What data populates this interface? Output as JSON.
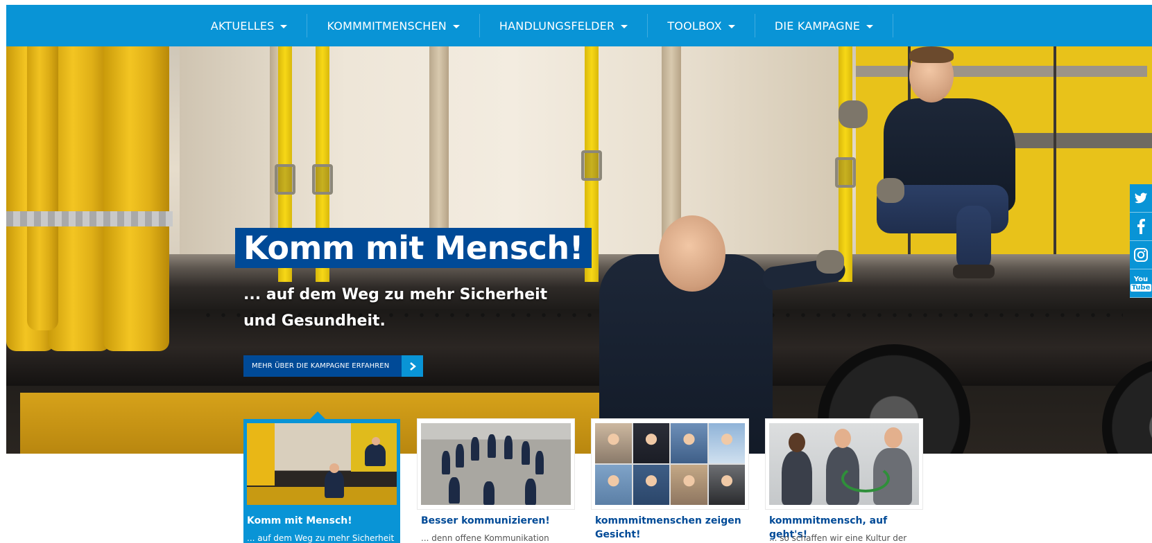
{
  "nav": {
    "items": [
      {
        "label": "AKTUELLES"
      },
      {
        "label": "KOMMMITMENSCHEN"
      },
      {
        "label": "HANDLUNGSFELDER"
      },
      {
        "label": "TOOLBOX"
      },
      {
        "label": "DIE KAMPAGNE"
      }
    ]
  },
  "hero": {
    "title": "Komm mit Mensch!",
    "subtitle_line1": "... auf dem Weg zu mehr Sicherheit",
    "subtitle_line2": "und Gesundheit.",
    "button_label": "MEHR ÜBER DIE KAMPAGNE ERFAHREN"
  },
  "social": {
    "items": [
      {
        "icon": "twitter-icon"
      },
      {
        "icon": "facebook-icon"
      },
      {
        "icon": "instagram-icon"
      },
      {
        "icon": "youtube-icon",
        "label_top": "You",
        "label_bottom": "Tube"
      }
    ]
  },
  "cards": [
    {
      "title": "Komm mit Mensch!",
      "text": "... auf dem Weg zu mehr Sicherheit",
      "active": true
    },
    {
      "title": "Besser kommunizieren!",
      "text": "... denn offene Kommunikation",
      "active": false
    },
    {
      "title": "kommmitmenschen zeigen Gesicht!",
      "text": "",
      "active": false
    },
    {
      "title": "kommmitmensch, auf geht's!",
      "text": "... so schaffen wir eine Kultur der",
      "active": false
    }
  ],
  "colors": {
    "primary_blue": "#0994d6",
    "dark_blue": "#004a97",
    "yellow": "#f3c522"
  }
}
